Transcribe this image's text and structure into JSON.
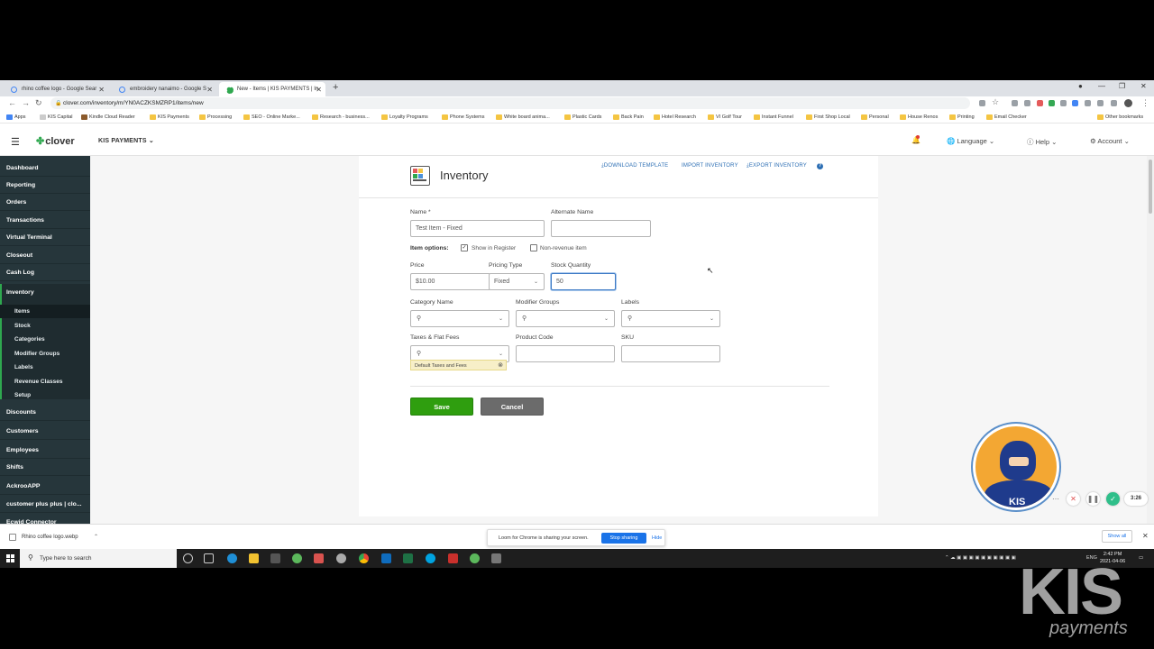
{
  "browser": {
    "tabs": [
      {
        "label": "rhino coffee logo - Google Sear"
      },
      {
        "label": "embroidery nanaimo - Google S"
      },
      {
        "label": "New - Items | KIS PAYMENTS | In"
      }
    ],
    "url": "clover.com/inventory/m/YN0ACZKSMZRP1/items/new",
    "bookmarks": [
      "Apps",
      "KIS Capital",
      "Kindle Cloud Reader",
      "KIS Payments",
      "Processing",
      "SEO - Online Marke...",
      "Research - business...",
      "Loyalty Programs",
      "Phone Systems",
      "White board anima...",
      "Plastic Cards",
      "Back Pain",
      "Hotel Research",
      "VI Golf Tour",
      "Instant Funnel",
      "First Shop Local",
      "Personal",
      "House Renos",
      "Printing",
      "Email Checker"
    ],
    "other_bookmarks": "Other bookmarks"
  },
  "header": {
    "logo": "clover",
    "merchant": "KIS PAYMENTS",
    "language": "Language",
    "help": "Help",
    "account": "Account"
  },
  "sidebar": {
    "top_items": [
      "Dashboard",
      "Reporting",
      "Orders",
      "Transactions",
      "Virtual Terminal",
      "Closeout",
      "Cash Log"
    ],
    "section": "Inventory",
    "sub_items": [
      "Items",
      "Stock",
      "Categories",
      "Modifier Groups",
      "Labels",
      "Revenue Classes",
      "Setup"
    ],
    "active_sub": "Items",
    "bottom_items": [
      "Discounts",
      "Customers",
      "Employees",
      "Shifts",
      "AckrooAPP",
      "customer plus plus | clo...",
      "Ecwid Connector"
    ]
  },
  "page": {
    "title": "Inventory",
    "links": {
      "download": "DOWNLOAD TEMPLATE",
      "import": "IMPORT INVENTORY",
      "export": "EXPORT INVENTORY"
    }
  },
  "form": {
    "name_label": "Name *",
    "name_value": "Test Item - Fixed",
    "alt_name_label": "Alternate Name",
    "alt_name_value": "",
    "item_options_label": "Item options:",
    "show_in_register": "Show in Register",
    "show_in_register_checked": true,
    "non_revenue": "Non-revenue item",
    "non_revenue_checked": false,
    "price_label": "Price",
    "price_value": "$10.00",
    "pricing_type_label": "Pricing Type",
    "pricing_type_value": "Fixed",
    "stock_label": "Stock Quantity",
    "stock_value": "50",
    "category_label": "Category Name",
    "modifier_label": "Modifier Groups",
    "labels_label": "Labels",
    "taxes_label": "Taxes & Flat Fees",
    "product_code_label": "Product Code",
    "sku_label": "SKU",
    "tax_tag": "Default Taxes and Fees",
    "save": "Save",
    "cancel": "Cancel"
  },
  "loom": {
    "time": "3:26"
  },
  "downloads": {
    "file": "Rhino coffee logo.webp",
    "share_text": "Loom for Chrome is sharing your screen.",
    "stop_sharing": "Stop sharing",
    "hide": "Hide",
    "show_all": "Show all"
  },
  "taskbar": {
    "search_placeholder": "Type here to search",
    "lang": "ENG",
    "time": "2:42 PM",
    "date": "2021-04-06"
  },
  "watermark": {
    "big": "KIS",
    "small": "payments"
  },
  "colors": {
    "sidebar_bg": "#26363b",
    "save_green": "#2f9e0f",
    "link_blue": "#2d6fb4",
    "clover_green": "#2fa84f"
  }
}
